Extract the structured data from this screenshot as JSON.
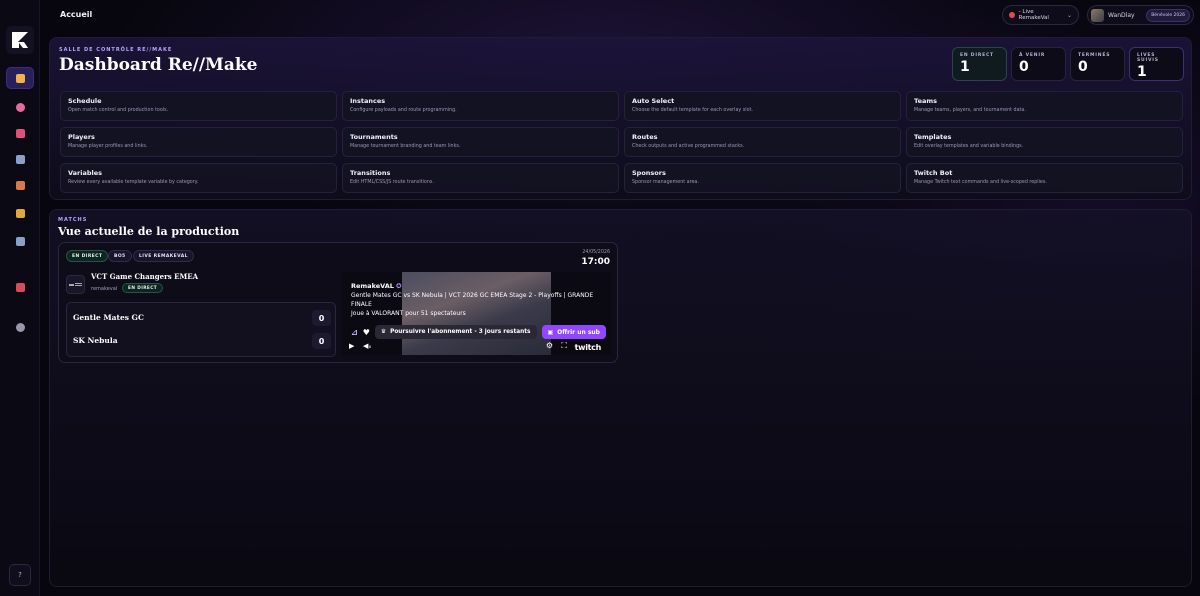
{
  "topbar": {
    "breadcrumb": "Accueil",
    "live_select": "- Live RemakeVal",
    "user_name": "WanDlay",
    "user_role": "Bénévole 2026"
  },
  "sidebar": {
    "items": [
      {
        "icon": "home-icon",
        "active": true,
        "color": "#f0b24a"
      },
      {
        "icon": "palette-icon",
        "active": false,
        "color": "#e66aa2"
      },
      {
        "icon": "pin-icon",
        "active": false,
        "color": "#e0507a"
      },
      {
        "icon": "calendar-icon",
        "active": false,
        "color": "#8aa0c8"
      },
      {
        "icon": "package-icon",
        "active": false,
        "color": "#d9794a"
      },
      {
        "icon": "folder-icon",
        "active": false,
        "color": "#e0a93a"
      },
      {
        "icon": "chart-icon",
        "active": false,
        "color": "#8aa0c8"
      },
      {
        "icon": "joystick-icon",
        "active": false,
        "color": "#d94a5a"
      },
      {
        "icon": "gear-icon",
        "active": false,
        "color": "#9a98a8"
      }
    ],
    "help_label": "?"
  },
  "hero": {
    "eyebrow": "SALLE DE CONTRÔLE RE//MAKE",
    "title": "Dashboard Re//Make",
    "stats": [
      {
        "label": "EN DIRECT",
        "value": "1"
      },
      {
        "label": "À VENIR",
        "value": "0"
      },
      {
        "label": "TERMINÉS",
        "value": "0"
      },
      {
        "label": "LIVES SUIVIS",
        "value": "1"
      }
    ],
    "cards": [
      {
        "title": "Schedule",
        "desc": "Open match control and production tools."
      },
      {
        "title": "Instances",
        "desc": "Configure payloads and route programming."
      },
      {
        "title": "Auto Select",
        "desc": "Choose the default template for each overlay slot."
      },
      {
        "title": "Teams",
        "desc": "Manage teams, players, and tournament data."
      },
      {
        "title": "Players",
        "desc": "Manage player profiles and links."
      },
      {
        "title": "Tournaments",
        "desc": "Manage tournament branding and team links."
      },
      {
        "title": "Routes",
        "desc": "Check outputs and active programmed stacks."
      },
      {
        "title": "Templates",
        "desc": "Edit overlay templates and variable bindings."
      },
      {
        "title": "Variables",
        "desc": "Review every available template variable by category."
      },
      {
        "title": "Transitions",
        "desc": "Edit HTML/CSS/JS route transitions."
      },
      {
        "title": "Sponsors",
        "desc": "Sponsor management area."
      },
      {
        "title": "Twitch Bot",
        "desc": "Manage Twitch text commands and live-scoped replies."
      }
    ]
  },
  "matches": {
    "eyebrow": "MATCHS",
    "title": "Vue actuelle de la production",
    "card": {
      "pills": [
        "EN DIRECT",
        "BO5",
        "LIVE REMAKEVAL"
      ],
      "date": "24/05/2026",
      "time": "17:00",
      "event": "VCT Game Changers EMEA",
      "channel": "remakeval",
      "status": "EN DIRECT",
      "teams": [
        {
          "name": "Gentle Mates GC",
          "score": "0"
        },
        {
          "name": "SK Nebula",
          "score": "0"
        }
      ],
      "stream": {
        "channel_name": "RemakeVAL",
        "title": "Gentle Mates GC vs SK Nebula | VCT 2026 GC EMEA Stage 2 - Playoffs | GRANDE FINALE",
        "playing": "Joue à VALORANT pour 51 spectateurs",
        "sub_label": "Poursuivre l'abonnement - 3 jours restants",
        "gift_label": "Offrir un sub",
        "brand": "twitch"
      }
    }
  }
}
